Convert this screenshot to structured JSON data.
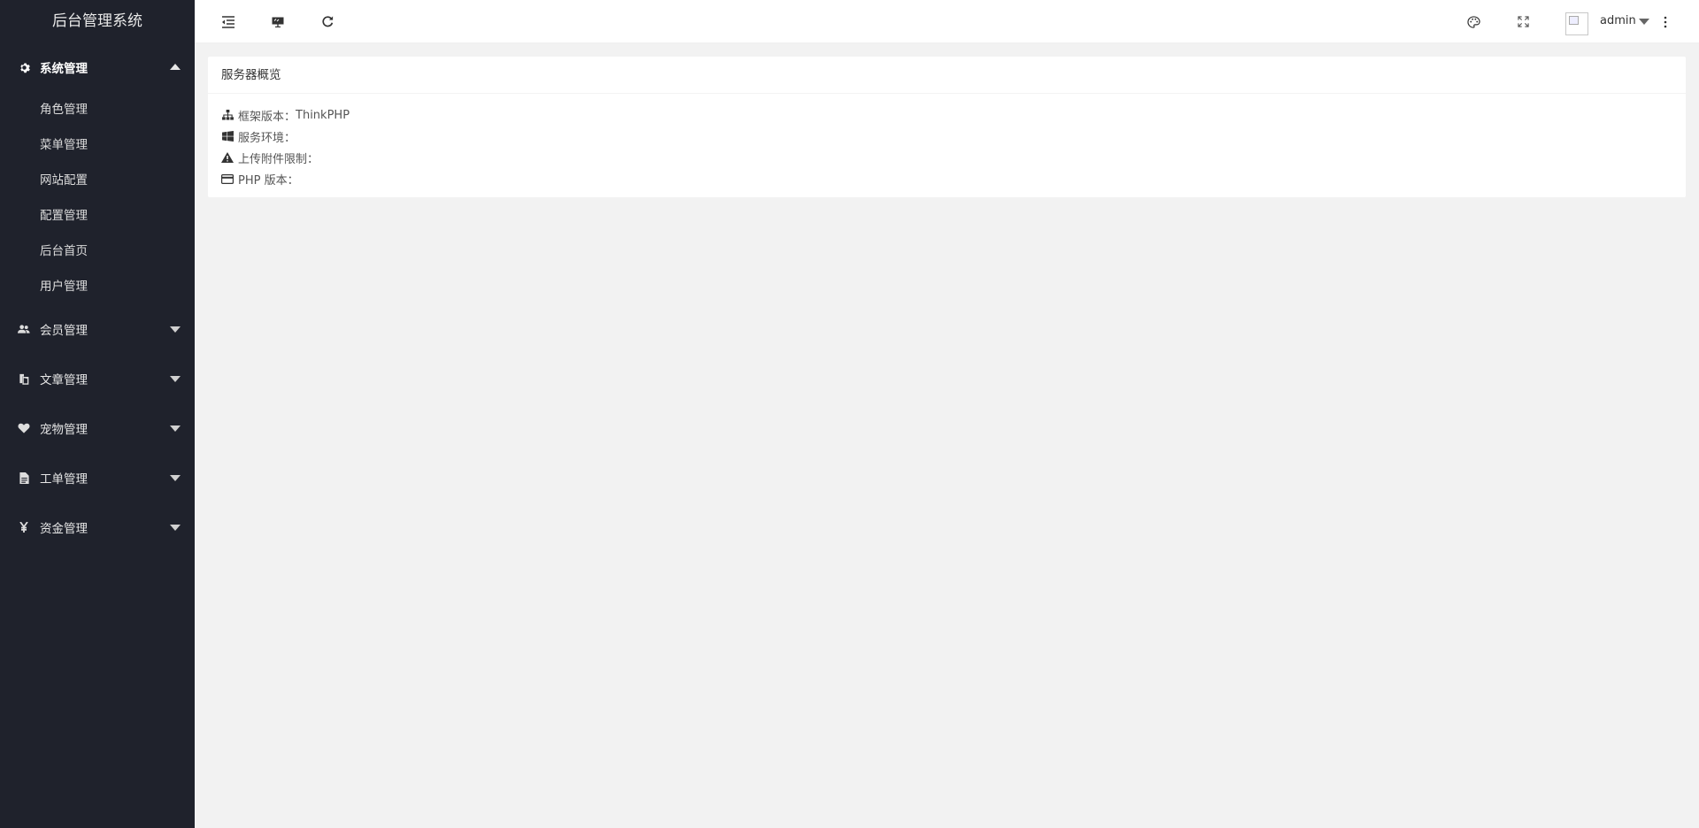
{
  "app": {
    "title": "后台管理系统"
  },
  "sidebar": {
    "groups": [
      {
        "label": "系统管理",
        "icon": "gear-icon",
        "expanded": true,
        "items": [
          {
            "label": "角色管理"
          },
          {
            "label": "菜单管理"
          },
          {
            "label": "网站配置"
          },
          {
            "label": "配置管理"
          },
          {
            "label": "后台首页"
          },
          {
            "label": "用户管理"
          }
        ]
      },
      {
        "label": "会员管理",
        "icon": "users-icon",
        "expanded": false
      },
      {
        "label": "文章管理",
        "icon": "copy-icon",
        "expanded": false
      },
      {
        "label": "宠物管理",
        "icon": "heart-icon",
        "expanded": false
      },
      {
        "label": "工单管理",
        "icon": "file-icon",
        "expanded": false
      },
      {
        "label": "资金管理",
        "icon": "yen-icon",
        "expanded": false
      }
    ]
  },
  "topbar": {
    "icons": [
      "menu-toggle-icon",
      "website-icon",
      "refresh-icon",
      "theme-icon",
      "fullscreen-icon",
      "more-icon"
    ],
    "user": {
      "name": "admin"
    }
  },
  "server_card": {
    "title": "服务器概览",
    "rows": [
      {
        "icon": "sitemap-icon",
        "label": "框架版本：",
        "value": "ThinkPHP"
      },
      {
        "icon": "windows-icon",
        "label": "服务环境：",
        "value": ""
      },
      {
        "icon": "warning-icon",
        "label": "上传附件限制：",
        "value": ""
      },
      {
        "icon": "credit-card-icon",
        "label": "PHP 版本：",
        "value": ""
      }
    ]
  },
  "colors": {
    "sidebar_bg": "#1f222c",
    "page_bg": "#f2f2f2"
  }
}
